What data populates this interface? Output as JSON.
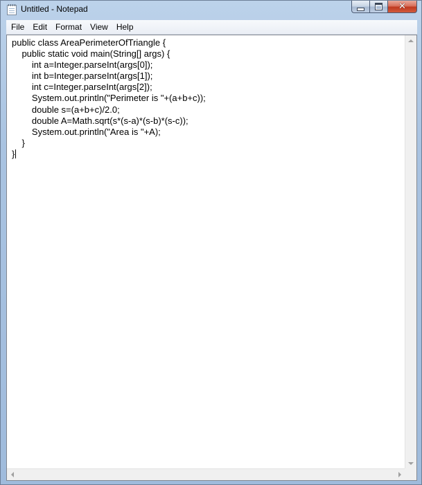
{
  "window": {
    "title": "Untitled - Notepad",
    "app_icon": "notepad-icon"
  },
  "caption_buttons": {
    "minimize_icon": "minimize-icon",
    "maximize_icon": "maximize-icon",
    "close_icon": "close-icon",
    "close_glyph": "✕"
  },
  "menu": {
    "items": [
      {
        "label": "File"
      },
      {
        "label": "Edit"
      },
      {
        "label": "Format"
      },
      {
        "label": "View"
      },
      {
        "label": "Help"
      }
    ]
  },
  "editor": {
    "text": "public class AreaPerimeterOfTriangle {\n    public static void main(String[] args) {\n        int a=Integer.parseInt(args[0]);\n        int b=Integer.parseInt(args[1]);\n        int c=Integer.parseInt(args[2]);\n        System.out.println(\"Perimeter is \"+(a+b+c));\n        double s=(a+b+c)/2.0;\n        double A=Math.sqrt(s*(s-a)*(s-b)*(s-c));\n        System.out.println(\"Area is \"+A);\n    }\n}"
  },
  "colors": {
    "frame": "#a9c3e1",
    "close_button": "#c0391f",
    "text": "#000000",
    "background": "#ffffff"
  }
}
